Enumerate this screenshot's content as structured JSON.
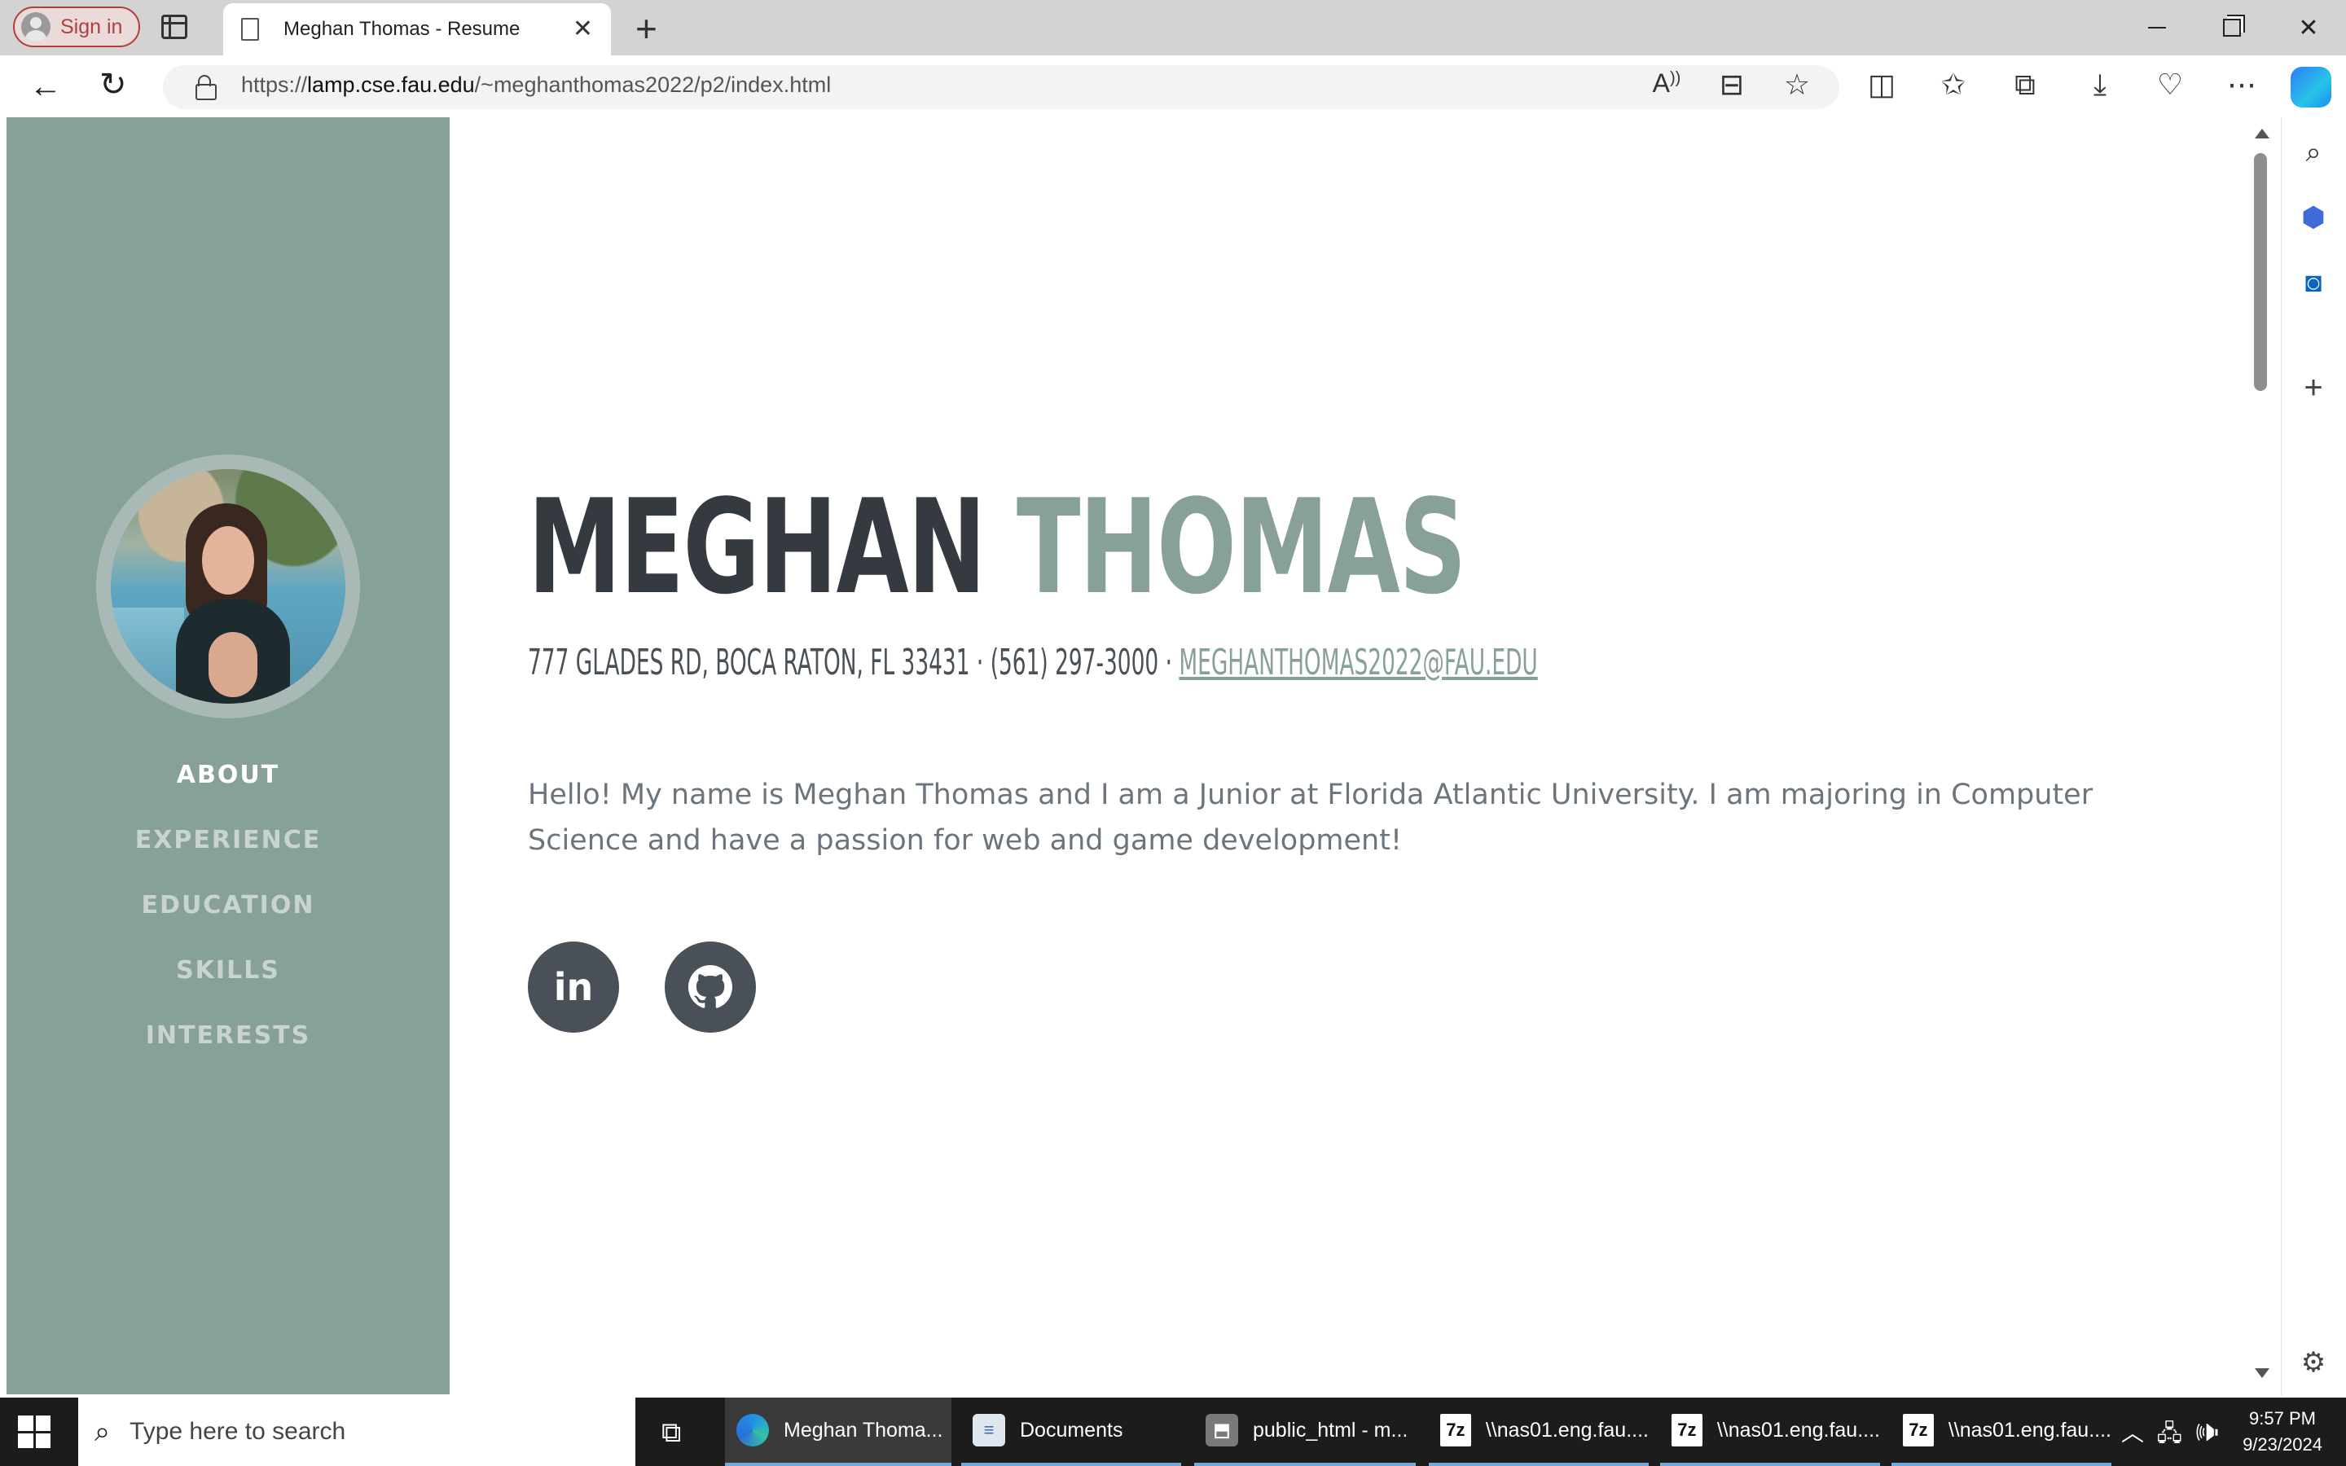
{
  "browser": {
    "signin_label": "Sign in",
    "tab_title": "Meghan Thomas - Resume",
    "url_prefix": "https://",
    "url_host": "lamp.cse.fau.edu",
    "url_path": "/~meghanthomas2022/p2/index.html"
  },
  "page": {
    "first_name": "MEGHAN",
    "last_name": "THOMAS",
    "address_phone": "777 Glades Rd, Boca Raton, FL 33431 · (561) 297-3000 · ",
    "email": "meghanthomas2022@fau.edu",
    "bio": "Hello! My name is Meghan Thomas and I am a Junior at Florida Atlantic University. I am majoring in Computer Science and have a passion for web and game development!",
    "social": {
      "linkedin_glyph": "in"
    },
    "nav": [
      {
        "label": "ABOUT",
        "active": true
      },
      {
        "label": "EXPERIENCE"
      },
      {
        "label": "EDUCATION"
      },
      {
        "label": "SKILLS"
      },
      {
        "label": "INTERESTS"
      }
    ]
  },
  "colors": {
    "sidebar": "#88a09a",
    "name_dark": "#343a40",
    "social_bg": "#495057"
  },
  "taskbar": {
    "search_placeholder": "Type here to search",
    "apps": [
      {
        "label": "Meghan Thoma...",
        "icon": "edge-icon"
      },
      {
        "label": "Documents",
        "icon": "document-icon"
      },
      {
        "label": "public_html - m...",
        "icon": "ftp-icon"
      },
      {
        "label": "\\\\nas01.eng.fau....",
        "icon": "7zip-icon",
        "icon_text": "7z"
      },
      {
        "label": "\\\\nas01.eng.fau....",
        "icon": "7zip-icon",
        "icon_text": "7z"
      },
      {
        "label": "\\\\nas01.eng.fau....",
        "icon": "7zip-icon",
        "icon_text": "7z"
      }
    ],
    "time": "9:57 PM",
    "date": "9/23/2024"
  }
}
